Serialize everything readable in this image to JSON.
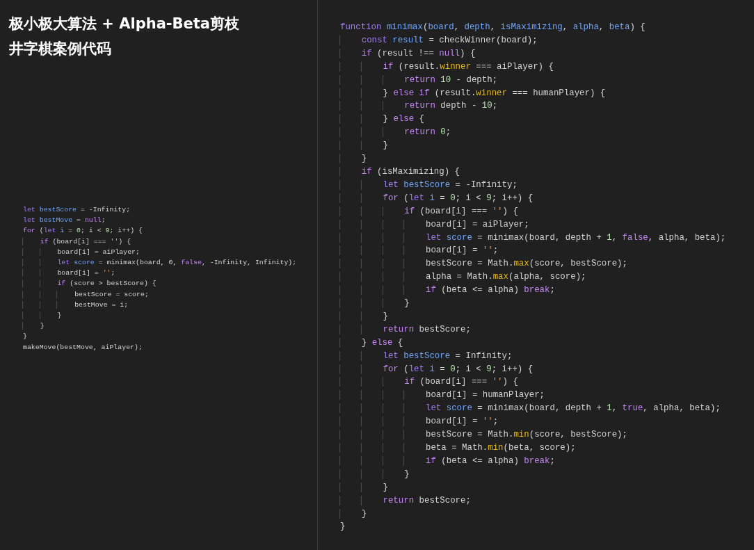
{
  "title": {
    "lines": [
      "极小极大算法 + Alpha-Beta剪枝",
      "井字棋案例代码"
    ]
  },
  "snippet": {
    "lines": [
      {
        "tokens": [
          {
            "kind": "kw",
            "text": "let"
          },
          {
            "kind": "var",
            "text": " bestScore"
          },
          {
            "kind": "p",
            "text": " = -Infinity;"
          }
        ]
      },
      {
        "tokens": [
          {
            "kind": "kw",
            "text": "let"
          },
          {
            "kind": "var",
            "text": " bestMove"
          },
          {
            "kind": "p",
            "text": " = "
          },
          {
            "kind": "ctl",
            "text": "null"
          },
          {
            "kind": "p",
            "text": ";"
          }
        ]
      },
      {
        "tokens": [
          {
            "kind": "ctl",
            "text": "for"
          },
          {
            "kind": "p",
            "text": " ("
          },
          {
            "kind": "kw",
            "text": "let"
          },
          {
            "kind": "var",
            "text": " i"
          },
          {
            "kind": "p",
            "text": " = "
          },
          {
            "kind": "num",
            "text": "0"
          },
          {
            "kind": "p",
            "text": "; i < "
          },
          {
            "kind": "num",
            "text": "9"
          },
          {
            "kind": "p",
            "text": "; i++) {"
          }
        ]
      },
      {
        "tokens": [
          {
            "kind": "ctl",
            "text": "    if"
          },
          {
            "kind": "p",
            "text": " (board[i] === "
          },
          {
            "kind": "str",
            "text": "''"
          },
          {
            "kind": "p",
            "text": ") {"
          }
        ]
      },
      {
        "tokens": [
          {
            "kind": "p",
            "text": "        board[i] = aiPlayer;"
          }
        ]
      },
      {
        "tokens": [
          {
            "kind": "kw",
            "text": "        let"
          },
          {
            "kind": "var",
            "text": " score"
          },
          {
            "kind": "p",
            "text": " = minimax(board, "
          },
          {
            "kind": "num",
            "text": "0"
          },
          {
            "kind": "p",
            "text": ", "
          },
          {
            "kind": "ctl",
            "text": "false"
          },
          {
            "kind": "p",
            "text": ", -Infinity, Infinity);"
          }
        ]
      },
      {
        "tokens": [
          {
            "kind": "p",
            "text": "        board[i] = "
          },
          {
            "kind": "str",
            "text": "''"
          },
          {
            "kind": "p",
            "text": ";"
          }
        ]
      },
      {
        "tokens": [
          {
            "kind": "ctl",
            "text": "        if"
          },
          {
            "kind": "p",
            "text": " (score > bestScore) {"
          }
        ]
      },
      {
        "tokens": [
          {
            "kind": "p",
            "text": "            bestScore = score;"
          }
        ]
      },
      {
        "tokens": [
          {
            "kind": "p",
            "text": "            bestMove = i;"
          }
        ]
      },
      {
        "tokens": [
          {
            "kind": "p",
            "text": "        }"
          }
        ]
      },
      {
        "tokens": [
          {
            "kind": "p",
            "text": "    }"
          }
        ]
      },
      {
        "tokens": [
          {
            "kind": "p",
            "text": "}"
          }
        ]
      },
      {
        "tokens": [
          {
            "kind": "p",
            "text": "makeMove(bestMove, aiPlayer);"
          }
        ]
      }
    ]
  },
  "code": {
    "lines": [
      {
        "tokens": [
          {
            "kind": "kw",
            "text": "function"
          },
          {
            "kind": "var",
            "text": " minimax"
          },
          {
            "kind": "p",
            "text": "("
          },
          {
            "kind": "var",
            "text": "board"
          },
          {
            "kind": "p",
            "text": ", "
          },
          {
            "kind": "var",
            "text": "depth"
          },
          {
            "kind": "p",
            "text": ", "
          },
          {
            "kind": "var",
            "text": "isMaximizing"
          },
          {
            "kind": "p",
            "text": ", "
          },
          {
            "kind": "var",
            "text": "alpha"
          },
          {
            "kind": "p",
            "text": ", "
          },
          {
            "kind": "var",
            "text": "beta"
          },
          {
            "kind": "p",
            "text": ") {"
          }
        ]
      },
      {
        "tokens": [
          {
            "kind": "kw",
            "text": "    const"
          },
          {
            "kind": "var",
            "text": " result"
          },
          {
            "kind": "p",
            "text": " = checkWinner(board);"
          }
        ]
      },
      {
        "tokens": [
          {
            "kind": "ctl",
            "text": "    if"
          },
          {
            "kind": "p",
            "text": " (result !== "
          },
          {
            "kind": "ctl",
            "text": "null"
          },
          {
            "kind": "p",
            "text": ") {"
          }
        ]
      },
      {
        "tokens": [
          {
            "kind": "ctl",
            "text": "        if"
          },
          {
            "kind": "p",
            "text": " (result."
          },
          {
            "kind": "prop",
            "text": "winner"
          },
          {
            "kind": "p",
            "text": " === aiPlayer) {"
          }
        ]
      },
      {
        "tokens": [
          {
            "kind": "ctl",
            "text": "            return"
          },
          {
            "kind": "num",
            "text": " 10"
          },
          {
            "kind": "p",
            "text": " - depth;"
          }
        ]
      },
      {
        "tokens": [
          {
            "kind": "p",
            "text": "        } "
          },
          {
            "kind": "ctl",
            "text": "else if"
          },
          {
            "kind": "p",
            "text": " (result."
          },
          {
            "kind": "prop",
            "text": "winner"
          },
          {
            "kind": "p",
            "text": " === humanPlayer) {"
          }
        ]
      },
      {
        "tokens": [
          {
            "kind": "ctl",
            "text": "            return"
          },
          {
            "kind": "p",
            "text": " depth - "
          },
          {
            "kind": "num",
            "text": "10"
          },
          {
            "kind": "p",
            "text": ";"
          }
        ]
      },
      {
        "tokens": [
          {
            "kind": "p",
            "text": "        } "
          },
          {
            "kind": "ctl",
            "text": "else"
          },
          {
            "kind": "p",
            "text": " {"
          }
        ]
      },
      {
        "tokens": [
          {
            "kind": "ctl",
            "text": "            return"
          },
          {
            "kind": "num",
            "text": " 0"
          },
          {
            "kind": "p",
            "text": ";"
          }
        ]
      },
      {
        "tokens": [
          {
            "kind": "p",
            "text": "        }"
          }
        ]
      },
      {
        "tokens": [
          {
            "kind": "p",
            "text": "    }"
          }
        ]
      },
      {
        "tokens": [
          {
            "kind": "ctl",
            "text": "    if"
          },
          {
            "kind": "p",
            "text": " (isMaximizing) {"
          }
        ]
      },
      {
        "tokens": [
          {
            "kind": "kw",
            "text": "        let"
          },
          {
            "kind": "var",
            "text": " bestScore"
          },
          {
            "kind": "p",
            "text": " = -Infinity;"
          }
        ]
      },
      {
        "tokens": [
          {
            "kind": "ctl",
            "text": "        for"
          },
          {
            "kind": "p",
            "text": " ("
          },
          {
            "kind": "kw",
            "text": "let"
          },
          {
            "kind": "var",
            "text": " i"
          },
          {
            "kind": "p",
            "text": " = "
          },
          {
            "kind": "num",
            "text": "0"
          },
          {
            "kind": "p",
            "text": "; i < "
          },
          {
            "kind": "num",
            "text": "9"
          },
          {
            "kind": "p",
            "text": "; i++) {"
          }
        ]
      },
      {
        "tokens": [
          {
            "kind": "ctl",
            "text": "            if"
          },
          {
            "kind": "p",
            "text": " (board[i] === "
          },
          {
            "kind": "str",
            "text": "''"
          },
          {
            "kind": "p",
            "text": ") {"
          }
        ]
      },
      {
        "tokens": [
          {
            "kind": "p",
            "text": "                board[i] = aiPlayer;"
          }
        ]
      },
      {
        "tokens": [
          {
            "kind": "kw",
            "text": "                let"
          },
          {
            "kind": "var",
            "text": " score"
          },
          {
            "kind": "p",
            "text": " = minimax(board, depth + "
          },
          {
            "kind": "num",
            "text": "1"
          },
          {
            "kind": "p",
            "text": ", "
          },
          {
            "kind": "ctl",
            "text": "false"
          },
          {
            "kind": "p",
            "text": ", alpha, beta);"
          }
        ]
      },
      {
        "tokens": [
          {
            "kind": "p",
            "text": "                board[i] = "
          },
          {
            "kind": "str",
            "text": "''"
          },
          {
            "kind": "p",
            "text": ";"
          }
        ]
      },
      {
        "tokens": [
          {
            "kind": "p",
            "text": "                bestScore = Math."
          },
          {
            "kind": "prop",
            "text": "max"
          },
          {
            "kind": "p",
            "text": "(score, bestScore);"
          }
        ]
      },
      {
        "tokens": [
          {
            "kind": "p",
            "text": "                alpha = Math."
          },
          {
            "kind": "prop",
            "text": "max"
          },
          {
            "kind": "p",
            "text": "(alpha, score);"
          }
        ]
      },
      {
        "tokens": [
          {
            "kind": "ctl",
            "text": "                if"
          },
          {
            "kind": "p",
            "text": " (beta <= alpha) "
          },
          {
            "kind": "ctl",
            "text": "break"
          },
          {
            "kind": "p",
            "text": ";"
          }
        ]
      },
      {
        "tokens": [
          {
            "kind": "p",
            "text": "            }"
          }
        ]
      },
      {
        "tokens": [
          {
            "kind": "p",
            "text": "        }"
          }
        ]
      },
      {
        "tokens": [
          {
            "kind": "ctl",
            "text": "        return"
          },
          {
            "kind": "p",
            "text": " bestScore;"
          }
        ]
      },
      {
        "tokens": [
          {
            "kind": "p",
            "text": "    } "
          },
          {
            "kind": "ctl",
            "text": "else"
          },
          {
            "kind": "p",
            "text": " {"
          }
        ]
      },
      {
        "tokens": [
          {
            "kind": "kw",
            "text": "        let"
          },
          {
            "kind": "var",
            "text": " bestScore"
          },
          {
            "kind": "p",
            "text": " = Infinity;"
          }
        ]
      },
      {
        "tokens": [
          {
            "kind": "ctl",
            "text": "        for"
          },
          {
            "kind": "p",
            "text": " ("
          },
          {
            "kind": "kw",
            "text": "let"
          },
          {
            "kind": "var",
            "text": " i"
          },
          {
            "kind": "p",
            "text": " = "
          },
          {
            "kind": "num",
            "text": "0"
          },
          {
            "kind": "p",
            "text": "; i < "
          },
          {
            "kind": "num",
            "text": "9"
          },
          {
            "kind": "p",
            "text": "; i++) {"
          }
        ]
      },
      {
        "tokens": [
          {
            "kind": "ctl",
            "text": "            if"
          },
          {
            "kind": "p",
            "text": " (board[i] === "
          },
          {
            "kind": "str",
            "text": "''"
          },
          {
            "kind": "p",
            "text": ") {"
          }
        ]
      },
      {
        "tokens": [
          {
            "kind": "p",
            "text": "                board[i] = humanPlayer;"
          }
        ]
      },
      {
        "tokens": [
          {
            "kind": "kw",
            "text": "                let"
          },
          {
            "kind": "var",
            "text": " score"
          },
          {
            "kind": "p",
            "text": " = minimax(board, depth + "
          },
          {
            "kind": "num",
            "text": "1"
          },
          {
            "kind": "p",
            "text": ", "
          },
          {
            "kind": "ctl",
            "text": "true"
          },
          {
            "kind": "p",
            "text": ", alpha, beta);"
          }
        ]
      },
      {
        "tokens": [
          {
            "kind": "p",
            "text": "                board[i] = "
          },
          {
            "kind": "str",
            "text": "''"
          },
          {
            "kind": "p",
            "text": ";"
          }
        ]
      },
      {
        "tokens": [
          {
            "kind": "p",
            "text": "                bestScore = Math."
          },
          {
            "kind": "prop",
            "text": "min"
          },
          {
            "kind": "p",
            "text": "(score, bestScore);"
          }
        ]
      },
      {
        "tokens": [
          {
            "kind": "p",
            "text": "                beta = Math."
          },
          {
            "kind": "prop",
            "text": "min"
          },
          {
            "kind": "p",
            "text": "(beta, score);"
          }
        ]
      },
      {
        "tokens": [
          {
            "kind": "ctl",
            "text": "                if"
          },
          {
            "kind": "p",
            "text": " (beta <= alpha) "
          },
          {
            "kind": "ctl",
            "text": "break"
          },
          {
            "kind": "p",
            "text": ";"
          }
        ]
      },
      {
        "tokens": [
          {
            "kind": "p",
            "text": "            }"
          }
        ]
      },
      {
        "tokens": [
          {
            "kind": "p",
            "text": "        }"
          }
        ]
      },
      {
        "tokens": [
          {
            "kind": "ctl",
            "text": "        return"
          },
          {
            "kind": "p",
            "text": " bestScore;"
          }
        ]
      },
      {
        "tokens": [
          {
            "kind": "p",
            "text": "    }"
          }
        ]
      },
      {
        "tokens": [
          {
            "kind": "p",
            "text": "}"
          }
        ]
      }
    ]
  }
}
